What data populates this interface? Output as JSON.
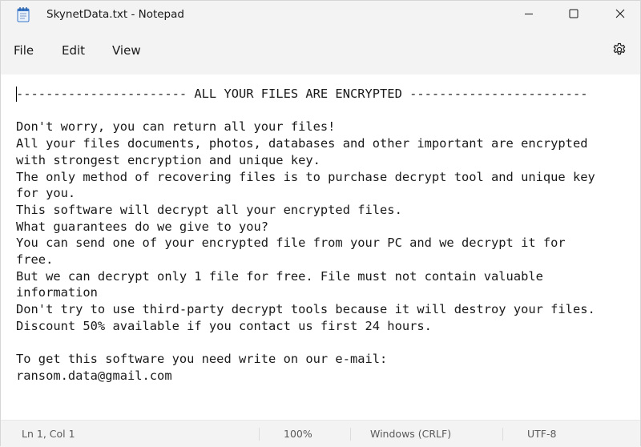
{
  "window": {
    "title": "SkynetData.txt - Notepad",
    "controls": {
      "minimize": "minimize",
      "maximize": "maximize",
      "close": "close"
    }
  },
  "menu": {
    "file": "File",
    "edit": "Edit",
    "view": "View"
  },
  "document": {
    "lines": [
      "----------------------- ALL YOUR FILES ARE ENCRYPTED ------------------------",
      "",
      "Don't worry, you can return all your files!",
      "All your files documents, photos, databases and other important are encrypted",
      "with strongest encryption and unique key.",
      "The only method of recovering files is to purchase decrypt tool and unique key",
      "for you.",
      "This software will decrypt all your encrypted files.",
      "What guarantees do we give to you?",
      "You can send one of your encrypted file from your PC and we decrypt it for",
      "free.",
      "But we can decrypt only 1 file for free. File must not contain valuable",
      "information",
      "Don't try to use third-party decrypt tools because it will destroy your files.",
      "Discount 50% available if you contact us first 24 hours.",
      "",
      "To get this software you need write on our e-mail:",
      "ransom.data@gmail.com"
    ]
  },
  "status": {
    "position": "Ln 1, Col 1",
    "zoom": "100%",
    "line_ending": "Windows (CRLF)",
    "encoding": "UTF-8"
  },
  "icons": {
    "app": "notepad-icon",
    "settings": "gear-icon"
  },
  "colors": {
    "chrome": "#f3f3f3",
    "editor": "#ffffff",
    "text": "#1a1a1a",
    "status_text": "#5a5a5a"
  }
}
